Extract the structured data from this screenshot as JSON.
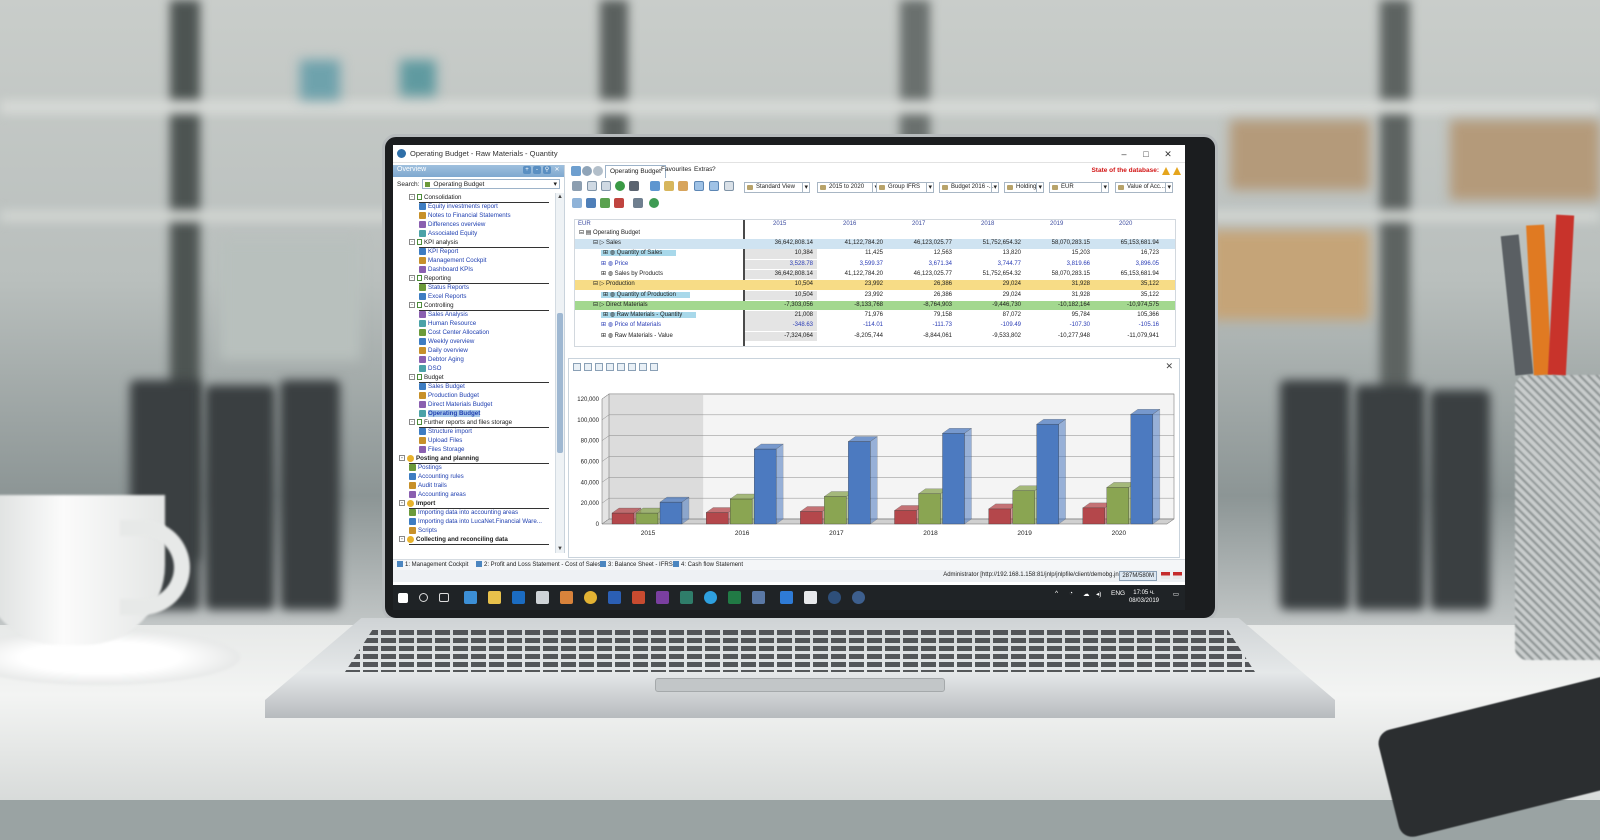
{
  "window": {
    "title": "Operating Budget - Raw Materials - Quantity"
  },
  "left_panel": {
    "header": "Overview",
    "search_label": "Search:",
    "search_value": "Operating Budget",
    "tree": [
      {
        "label": "Consolidation",
        "kind": "group",
        "indent": 1
      },
      {
        "label": "Equity investments report",
        "kind": "link",
        "indent": 2
      },
      {
        "label": "Notes to Financial Statements",
        "kind": "link",
        "indent": 2
      },
      {
        "label": "Differences overview",
        "kind": "link",
        "indent": 2
      },
      {
        "label": "Associated Equity",
        "kind": "link",
        "indent": 2
      },
      {
        "label": "KPI analysis",
        "kind": "group",
        "indent": 1
      },
      {
        "label": "KPI Report",
        "kind": "link",
        "indent": 2
      },
      {
        "label": "Management Cockpit",
        "kind": "link",
        "indent": 2
      },
      {
        "label": "Dashboard KPIs",
        "kind": "link",
        "indent": 2
      },
      {
        "label": "Reporting",
        "kind": "group",
        "indent": 1
      },
      {
        "label": "Status Reports",
        "kind": "link",
        "indent": 2
      },
      {
        "label": "Excel Reports",
        "kind": "link",
        "indent": 2
      },
      {
        "label": "Controlling",
        "kind": "group",
        "indent": 1
      },
      {
        "label": "Sales Analysis",
        "kind": "link",
        "indent": 2
      },
      {
        "label": "Human Resource",
        "kind": "link",
        "indent": 2
      },
      {
        "label": "Cost Center Allocation",
        "kind": "link",
        "indent": 2
      },
      {
        "label": "Weekly overview",
        "kind": "link",
        "indent": 2
      },
      {
        "label": "Daily overview",
        "kind": "link",
        "indent": 2
      },
      {
        "label": "Debtor Aging",
        "kind": "link",
        "indent": 2
      },
      {
        "label": "DSO",
        "kind": "link",
        "indent": 2
      },
      {
        "label": "Budget",
        "kind": "group",
        "indent": 1
      },
      {
        "label": "Sales Budget",
        "kind": "link",
        "indent": 2
      },
      {
        "label": "Production Budget",
        "kind": "link",
        "indent": 2
      },
      {
        "label": "Direct Materials Budget",
        "kind": "link",
        "indent": 2
      },
      {
        "label": "Operating Budget",
        "kind": "link",
        "indent": 2,
        "selected": true
      },
      {
        "label": "Further reports and files storage",
        "kind": "group",
        "indent": 1
      },
      {
        "label": "Structure import",
        "kind": "link",
        "indent": 2
      },
      {
        "label": "Upload Files",
        "kind": "link",
        "indent": 2
      },
      {
        "label": "Files Storage",
        "kind": "link",
        "indent": 2
      },
      {
        "label": "Posting and planning",
        "kind": "section",
        "indent": 0
      },
      {
        "label": "Postings",
        "kind": "link",
        "indent": 1
      },
      {
        "label": "Accounting rules",
        "kind": "link",
        "indent": 1
      },
      {
        "label": "Audit trails",
        "kind": "link",
        "indent": 1
      },
      {
        "label": "Accounting areas",
        "kind": "link",
        "indent": 1
      },
      {
        "label": "Import",
        "kind": "section",
        "indent": 0
      },
      {
        "label": "Importing data into accounting areas",
        "kind": "link",
        "indent": 1
      },
      {
        "label": "Importing data into LucaNet.Financial Ware...",
        "kind": "link",
        "indent": 1
      },
      {
        "label": "Scripts",
        "kind": "link",
        "indent": 1
      },
      {
        "label": "Collecting and reconciling data",
        "kind": "section",
        "indent": 0
      }
    ]
  },
  "menu": {
    "active_tab": "Operating Budget",
    "favourites": "Favourites",
    "extras": "Extras",
    "help": "?",
    "state_text": "State of the database:"
  },
  "toolbar": {
    "view": "Standard View",
    "period": "2015 to 2020",
    "ifrs": "Group IFRS",
    "budget": "Budget 2016 -...",
    "holding": "Holding",
    "currency": "EUR",
    "value": "Value of Acc..."
  },
  "grid": {
    "currency": "EUR",
    "years": [
      "2015",
      "2016",
      "2017",
      "2018",
      "2019",
      "2020"
    ],
    "root": "Operating Budget",
    "rows": [
      {
        "label": "Sales",
        "style": "bluebar",
        "indent": 1,
        "values": [
          "36,642,808.14",
          "41,122,784.20",
          "46,123,025.77",
          "51,752,654.32",
          "58,070,283.15",
          "65,153,681.94"
        ]
      },
      {
        "label": "Quantity of Sales",
        "style": "hl",
        "indent": 2,
        "values": [
          "10,384",
          "11,425",
          "12,563",
          "13,820",
          "15,203",
          "16,723"
        ]
      },
      {
        "label": "Price",
        "style": "blue",
        "indent": 2,
        "values": [
          "3,528.78",
          "3,599.37",
          "3,671.34",
          "3,744.77",
          "3,819.66",
          "3,896.05"
        ]
      },
      {
        "label": "Sales by Products",
        "style": "",
        "indent": 2,
        "values": [
          "36,642,808.14",
          "41,122,784.20",
          "46,123,025.77",
          "51,752,654.32",
          "58,070,283.15",
          "65,153,681.94"
        ]
      },
      {
        "label": "Production",
        "style": "yellow",
        "indent": 1,
        "values": [
          "10,504",
          "23,992",
          "26,386",
          "29,024",
          "31,928",
          "35,122"
        ]
      },
      {
        "label": "Quantity of Production",
        "style": "hl",
        "indent": 2,
        "values": [
          "10,504",
          "23,992",
          "26,386",
          "29,024",
          "31,928",
          "35,122"
        ]
      },
      {
        "label": "Direct Materials",
        "style": "green",
        "indent": 1,
        "values": [
          "-7,303,056",
          "-8,133,768",
          "-8,764,903",
          "-9,446,730",
          "-10,182,164",
          "-10,974,575"
        ]
      },
      {
        "label": "Raw Materials - Quantity",
        "style": "hl",
        "indent": 2,
        "values": [
          "21,008",
          "71,976",
          "79,158",
          "87,072",
          "95,784",
          "105,366"
        ]
      },
      {
        "label": "Price of Materials",
        "style": "blue",
        "indent": 2,
        "values": [
          "-348.63",
          "-114.01",
          "-111.73",
          "-109.49",
          "-107.30",
          "-105.16"
        ]
      },
      {
        "label": "Raw Materials - Value",
        "style": "",
        "indent": 2,
        "values": [
          "-7,324,064",
          "-8,205,744",
          "-8,844,061",
          "-9,533,802",
          "-10,277,948",
          "-11,079,941"
        ]
      }
    ]
  },
  "chart_data": {
    "type": "bar",
    "categories": [
      "2015",
      "2016",
      "2017",
      "2018",
      "2019",
      "2020"
    ],
    "series": [
      {
        "values": [
          10504,
          11000,
          12000,
          13000,
          14500,
          15500
        ],
        "color": "#b4474b"
      },
      {
        "values": [
          10504,
          23992,
          26386,
          29024,
          31928,
          35122
        ],
        "color": "#8aa552"
      },
      {
        "values": [
          21008,
          71976,
          79158,
          87072,
          95784,
          105366
        ],
        "color": "#4c7ac0"
      }
    ],
    "ylim": [
      0,
      120000
    ],
    "yticks": [
      "0",
      "20,000",
      "40,000",
      "60,000",
      "80,000",
      "100,000",
      "120,000"
    ],
    "grid": true
  },
  "sheets": [
    "1: Management Cockpit",
    "2: Profit and Loss Statement - Cost of Sales",
    "3: Balance Sheet - IFRS",
    "4: Cash flow Statement"
  ],
  "status": {
    "user": "Administrator [http://192.168.1.158:81/jnlp/jnlpfile/client/demobg.jnlp]",
    "memory": "287M/580M"
  },
  "taskbar": {
    "lang": "ENG",
    "time": "17:05 ч.",
    "date": "08/03/2019"
  },
  "colors": {
    "accent": "#7fa8cf",
    "state_red": "#d21414",
    "bar_red": "#b4474b",
    "bar_green": "#8aa552",
    "bar_blue": "#4c7ac0"
  }
}
